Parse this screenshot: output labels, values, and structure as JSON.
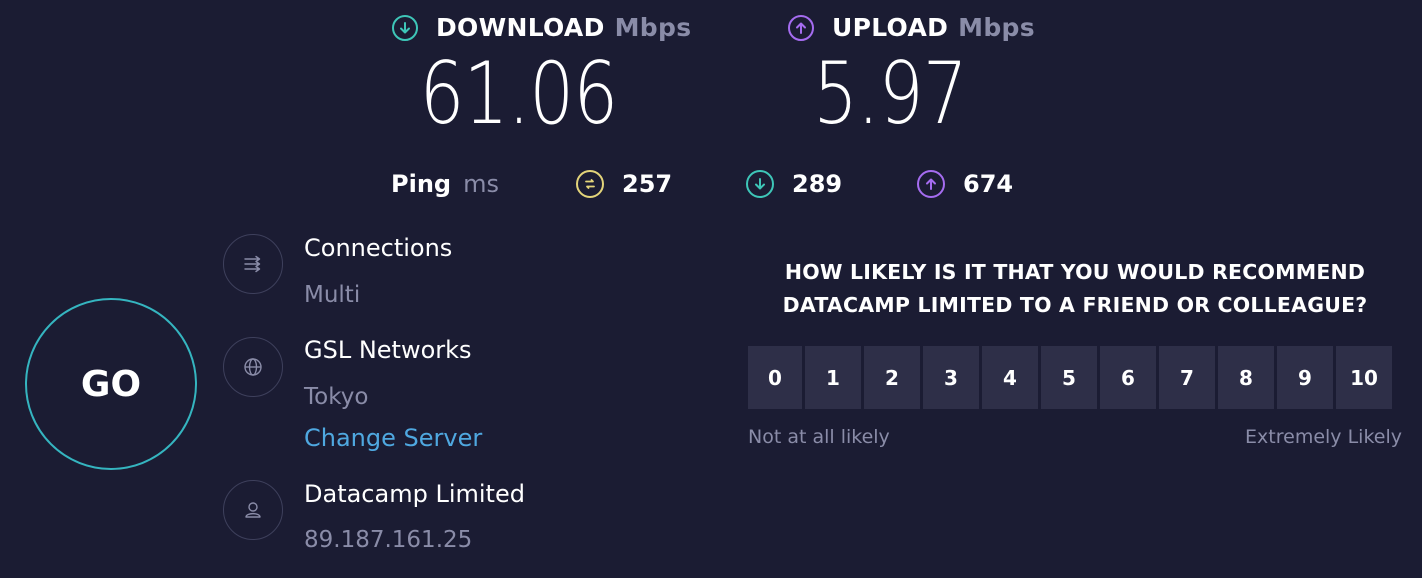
{
  "download": {
    "label": "DOWNLOAD",
    "unit": "Mbps",
    "value": "61.06",
    "icon": "download-arrow-icon",
    "color": "#3ec6b8"
  },
  "upload": {
    "label": "UPLOAD",
    "unit": "Mbps",
    "value": "5.97",
    "icon": "upload-arrow-icon",
    "color": "#a56cf0"
  },
  "ping": {
    "label": "Ping",
    "unit": "ms",
    "idle": {
      "value": "257",
      "icon": "ping-icon",
      "color": "#e3d47a"
    },
    "download": {
      "value": "289",
      "icon": "download-arrow-icon",
      "color": "#3ec6b8"
    },
    "upload": {
      "value": "674",
      "icon": "upload-arrow-icon",
      "color": "#a56cf0"
    }
  },
  "go_button": {
    "label": "GO",
    "color": "#35b5c0"
  },
  "connections": {
    "title": "Connections",
    "value": "Multi",
    "icon": "connections-icon"
  },
  "server": {
    "name": "GSL Networks",
    "location": "Tokyo",
    "change_label": "Change Server",
    "icon": "globe-icon"
  },
  "provider": {
    "name": "Datacamp Limited",
    "ip": "89.187.161.25",
    "icon": "user-icon"
  },
  "survey": {
    "question_line1": "HOW LIKELY IS IT THAT YOU WOULD RECOMMEND",
    "question_line2": "DATACAMP LIMITED TO A FRIEND OR COLLEAGUE?",
    "options": [
      "0",
      "1",
      "2",
      "3",
      "4",
      "5",
      "6",
      "7",
      "8",
      "9",
      "10"
    ],
    "low_label": "Not at all likely",
    "high_label": "Extremely Likely"
  },
  "colors": {
    "background": "#1b1c33",
    "muted": "#8a8ca8",
    "link": "#4fa8e0",
    "scale_bg": "#2e2f48"
  }
}
